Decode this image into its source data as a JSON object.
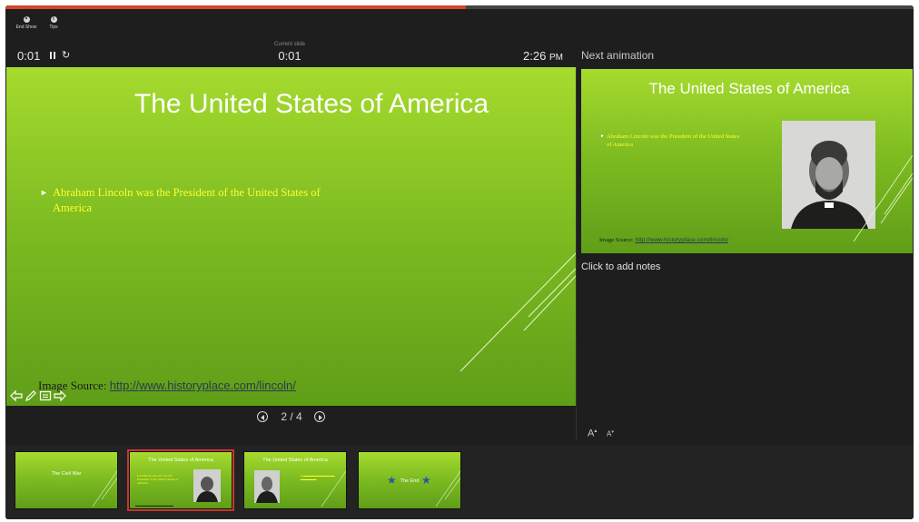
{
  "toolbar": {
    "end_show_label": "End Show",
    "tips_label": "Tips"
  },
  "progress": {
    "fraction": 0.507
  },
  "timer": {
    "elapsed": "0:01",
    "current_slide_label": "Current slide",
    "current_slide_time": "0:01"
  },
  "clock": {
    "time": "2:26",
    "ampm": "PM"
  },
  "next_animation_label": "Next animation",
  "current_slide": {
    "title": "The United States of America",
    "bullet": "Abraham Lincoln was the President of the United States of America",
    "image_source_label": "Image Source: ",
    "image_source_url": "http://www.historyplace.com/lincoln/"
  },
  "navigation": {
    "page_indicator": "2 / 4"
  },
  "next_slide": {
    "title": "The United States of America",
    "bullet": "Abraham Lincoln was the President of the United States of America",
    "image_source_label": "Image Source: ",
    "image_source_url": "http://www.historyplace.com/lincoln/"
  },
  "notes": {
    "placeholder": "Click to add notes"
  },
  "font_controls": {
    "increase": "A",
    "decrease": "A"
  },
  "thumbnails": [
    {
      "title": "The Civil War",
      "subtitle": "…",
      "active": false
    },
    {
      "title": "The United States of America",
      "active": true
    },
    {
      "title": "The United States of America",
      "active": false
    },
    {
      "title": "The End",
      "active": false
    }
  ],
  "colors": {
    "accent": "#d24726",
    "slide_green": "#8cc926",
    "bullet_yellow": "#ffff2b"
  }
}
